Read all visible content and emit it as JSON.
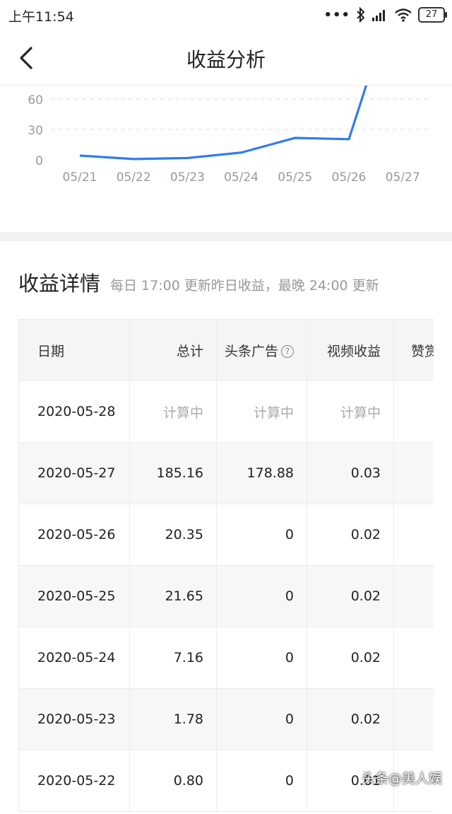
{
  "status_bar": {
    "time": "上午11:54",
    "battery": "27",
    "more_dots": "•••"
  },
  "header": {
    "title": "收益分析",
    "back_icon": "chevron-left-icon"
  },
  "chart_data": {
    "type": "line",
    "categories": [
      "05/21",
      "05/22",
      "05/23",
      "05/24",
      "05/25",
      "05/26",
      "05/27"
    ],
    "values": [
      4.2,
      0.8,
      1.78,
      7.16,
      21.65,
      20.35,
      185.16
    ],
    "y_ticks": [
      "0",
      "30",
      "60"
    ],
    "ylim": [
      0,
      60
    ],
    "grid": true,
    "line_color": "#2d7cf0"
  },
  "details": {
    "title": "收益详情",
    "subtitle": "每日 17:00 更新昨日收益，最晚 24:00 更新",
    "columns": [
      "日期",
      "总计",
      "头条广告",
      "视频收益",
      "赞赏"
    ],
    "rows": [
      [
        "2020-05-28",
        "计算中",
        "计算中",
        "计算中",
        ""
      ],
      [
        "2020-05-27",
        "185.16",
        "178.88",
        "0.03",
        ""
      ],
      [
        "2020-05-26",
        "20.35",
        "0",
        "0.02",
        ""
      ],
      [
        "2020-05-25",
        "21.65",
        "0",
        "0.02",
        ""
      ],
      [
        "2020-05-24",
        "7.16",
        "0",
        "0.02",
        ""
      ],
      [
        "2020-05-23",
        "1.78",
        "0",
        "0.02",
        ""
      ],
      [
        "2020-05-22",
        "0.80",
        "0",
        "0.01",
        ""
      ]
    ],
    "help_icon": "?"
  },
  "watermark": "头条@美人娱"
}
